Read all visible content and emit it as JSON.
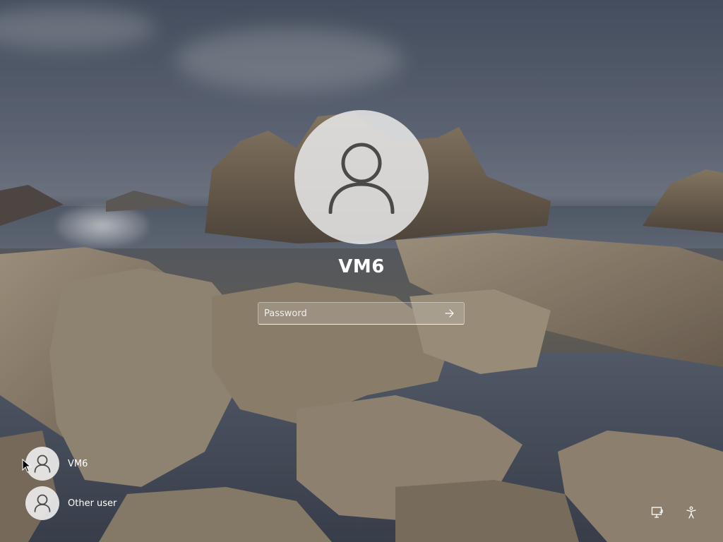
{
  "lock_screen": {
    "current_user": "VM6",
    "password_placeholder": "Password"
  },
  "user_list": [
    {
      "name": "VM6",
      "icon": "person-icon"
    },
    {
      "name": "Other user",
      "icon": "person-icon"
    }
  ],
  "tray": {
    "network_icon": "network-icon",
    "accessibility_icon": "accessibility-icon"
  },
  "colors": {
    "text": "#ffffff",
    "avatar_bg": "#e6e6e6",
    "icon_stroke": "#4a4a4a"
  }
}
